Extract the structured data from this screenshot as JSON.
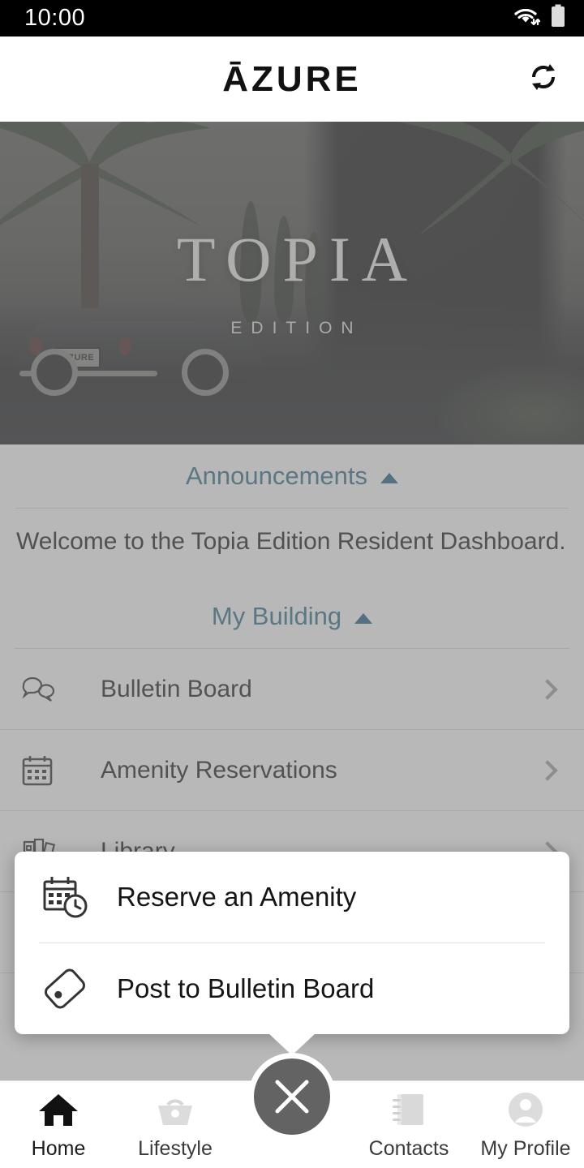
{
  "status_bar": {
    "time": "10:00",
    "wifi_icon": "wifi-icon",
    "battery_icon": "battery-full-icon"
  },
  "header": {
    "brand": "ĀZURE",
    "refresh_icon": "refresh-icon"
  },
  "hero": {
    "logo_main": "TOPIA",
    "logo_sub": "EDITION",
    "plate_text": "AZURE"
  },
  "sections": [
    {
      "key": "announcements",
      "title": "Announcements",
      "collapse_icon": "chevron-up-icon",
      "body": "Welcome to the Topia Edition Resident Dashboard."
    },
    {
      "key": "my_building",
      "title": "My Building",
      "collapse_icon": "chevron-up-icon"
    }
  ],
  "building_rows": [
    {
      "label": "Bulletin Board",
      "icon": "speech-bubbles-icon",
      "chevron": "chevron-right-icon"
    },
    {
      "label": "Amenity Reservations",
      "icon": "calendar-icon",
      "chevron": "chevron-right-icon"
    },
    {
      "label": "Library",
      "icon": "books-icon",
      "chevron": "chevron-right-icon"
    }
  ],
  "popup": {
    "items": [
      {
        "label": "Reserve an Amenity",
        "icon": "calendar-clock-icon"
      },
      {
        "label": "Post to Bulletin Board",
        "icon": "tag-icon"
      }
    ]
  },
  "bottom_nav": {
    "items": [
      {
        "label": "Home",
        "icon": "home-icon",
        "active": true
      },
      {
        "label": "Lifestyle",
        "icon": "basket-icon",
        "active": false
      },
      {
        "label": "Contacts",
        "icon": "address-book-icon",
        "active": false
      },
      {
        "label": "My Profile",
        "icon": "person-avatar-icon",
        "active": false
      }
    ],
    "center_button": {
      "icon": "close-x-icon",
      "label": ""
    }
  },
  "colors": {
    "accent_teal": "#2a6b87",
    "status_bar_bg": "#000000",
    "fab_bg": "#636363",
    "overlay": "#808080"
  }
}
